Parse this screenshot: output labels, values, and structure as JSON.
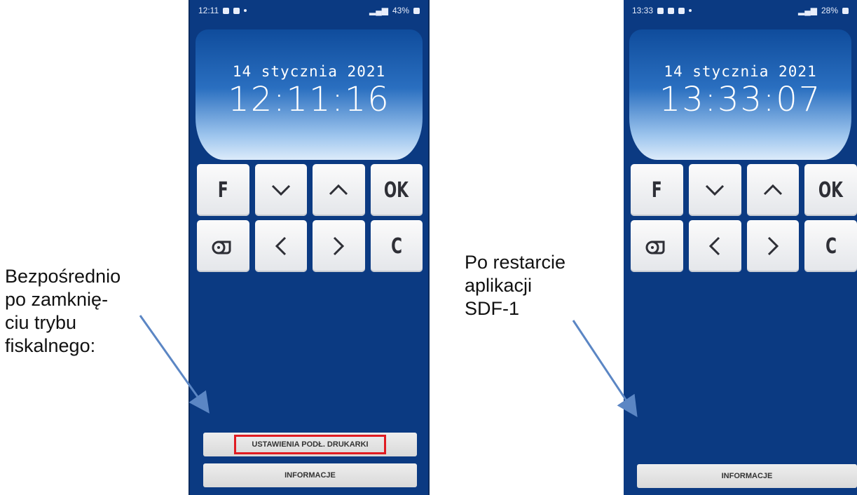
{
  "captions": {
    "left": "Bezpośrednio\npo zamknię-\nciu trybu\nfiskalnego:",
    "right": "Po restarcie\naplikacji\nSDF-1"
  },
  "phone_before": {
    "status_time": "12:11",
    "status_battery": "43%",
    "date": "14 stycznia 2021",
    "time": "12:11:16",
    "keys": [
      "F",
      "OK",
      "C"
    ],
    "settings_button": "USTAWIENIA PODŁ. DRUKARKI",
    "info_button": "INFORMACJE"
  },
  "phone_after": {
    "status_time": "13:33",
    "status_battery": "28%",
    "date": "14 stycznia 2021",
    "time": "13:33:07",
    "keys": [
      "F",
      "OK",
      "C"
    ],
    "info_button": "INFORMACJE"
  },
  "colors": {
    "phone_bg": "#0b3a82",
    "highlight": "#e01b22",
    "arrow": "#5b86c4"
  }
}
